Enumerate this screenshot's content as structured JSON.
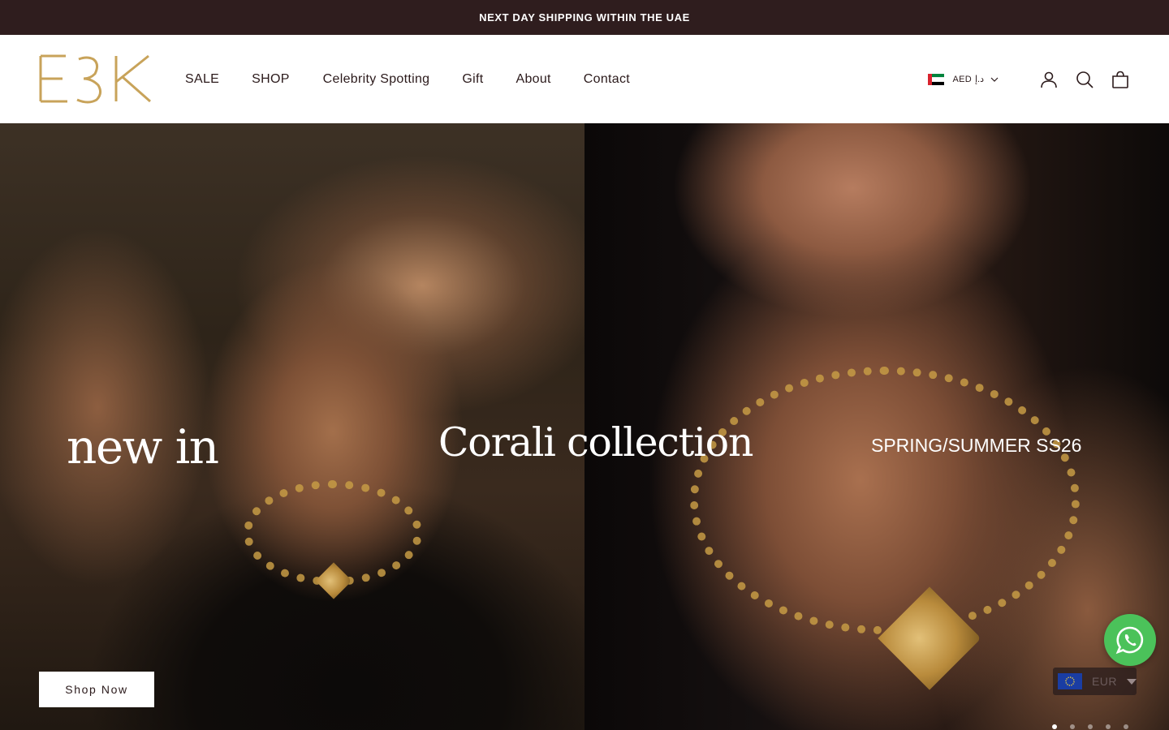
{
  "announcement": {
    "text": "NEXT DAY SHIPPING WITHIN THE UAE"
  },
  "brand": {
    "logo_text": "E3K",
    "logo_color": "#c8a35a"
  },
  "nav": {
    "items": [
      {
        "label": "SALE"
      },
      {
        "label": "SHOP"
      },
      {
        "label": "Celebrity Spotting"
      },
      {
        "label": "Gift"
      },
      {
        "label": "About"
      },
      {
        "label": "Contact"
      }
    ]
  },
  "header_tools": {
    "currency": {
      "flag": "uae-flag",
      "code": "AED",
      "symbol": "د.إ"
    },
    "icons": [
      "account-icon",
      "search-icon",
      "bag-icon"
    ]
  },
  "hero": {
    "left_text": "new in",
    "center_text": "Corali collection",
    "right_text": "SPRING/SUMMER SS26",
    "cta_label": "Shop Now",
    "slide_count": 5,
    "active_slide": 1
  },
  "widgets": {
    "whatsapp_icon": "whatsapp-icon",
    "currency_switch": {
      "flag": "eu-flag",
      "code": "EUR"
    }
  },
  "colors": {
    "announcement_bg": "#2f1d1e",
    "nav_text": "#2b1a1b",
    "whatsapp_green": "#4bc25a",
    "gold": "#c8a35a"
  }
}
